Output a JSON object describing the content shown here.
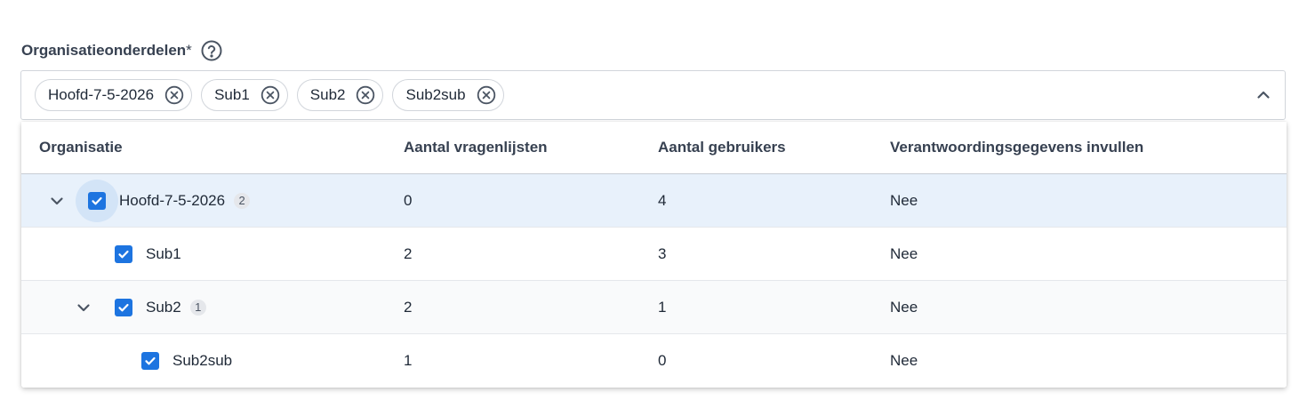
{
  "field": {
    "label": "Organisatieonderdelen",
    "required_mark": "*"
  },
  "chips": [
    {
      "label": "Hoofd-7-5-2026"
    },
    {
      "label": "Sub1"
    },
    {
      "label": "Sub2"
    },
    {
      "label": "Sub2sub"
    }
  ],
  "table": {
    "headers": [
      "Organisatie",
      "Aantal vragenlijsten",
      "Aantal gebruikers",
      "Verantwoordingsgegevens invullen"
    ],
    "rows": [
      {
        "name": "Hoofd-7-5-2026",
        "badge": "2",
        "vragenlijsten": "0",
        "gebruikers": "4",
        "verantwoording": "Nee",
        "checked": true,
        "expanded": true
      },
      {
        "name": "Sub1",
        "badge": "",
        "vragenlijsten": "2",
        "gebruikers": "3",
        "verantwoording": "Nee",
        "checked": true
      },
      {
        "name": "Sub2",
        "badge": "1",
        "vragenlijsten": "2",
        "gebruikers": "1",
        "verantwoording": "Nee",
        "checked": true,
        "expanded": true
      },
      {
        "name": "Sub2sub",
        "badge": "",
        "vragenlijsten": "1",
        "gebruikers": "0",
        "verantwoording": "Nee",
        "checked": true
      }
    ]
  },
  "icons": {
    "help": "help-circle-icon",
    "chip_remove": "close-circle-icon",
    "collapse": "chevron-up-icon",
    "expander": "chevron-down-icon",
    "checkbox": "check-icon"
  },
  "colors": {
    "accent": "#1d74e0",
    "selected_row": "#e8f1fb",
    "focus_ring": "#d3e4f7"
  }
}
